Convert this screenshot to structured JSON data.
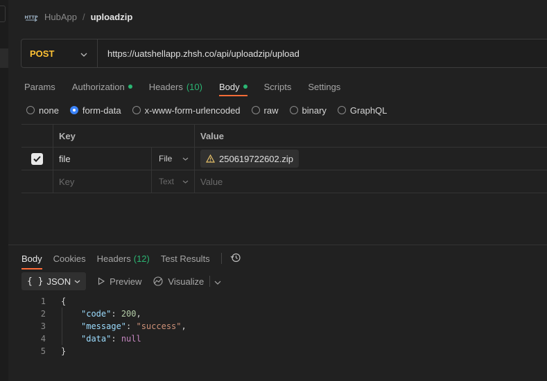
{
  "breadcrumb": {
    "parent": "HubApp",
    "separator": "/",
    "current": "uploadzip"
  },
  "request": {
    "method": "POST",
    "url": "https://uatshellapp.zhsh.co/api/uploadzip/upload"
  },
  "tabs": [
    {
      "label": "Params"
    },
    {
      "label": "Authorization"
    },
    {
      "label": "Headers",
      "count": "(10)"
    },
    {
      "label": "Body"
    },
    {
      "label": "Scripts"
    },
    {
      "label": "Settings"
    }
  ],
  "body_types": [
    "none",
    "form-data",
    "x-www-form-urlencoded",
    "raw",
    "binary",
    "GraphQL"
  ],
  "body_type_selected": "form-data",
  "form_table": {
    "headers": {
      "key": "Key",
      "value": "Value"
    },
    "rows": [
      {
        "checked": true,
        "key": "file",
        "type": "File",
        "value": "250619722602.zip"
      }
    ],
    "placeholder": {
      "key": "Key",
      "type": "Text",
      "value": "Value"
    }
  },
  "response_tabs": [
    {
      "label": "Body"
    },
    {
      "label": "Cookies"
    },
    {
      "label": "Headers",
      "count": "(12)"
    },
    {
      "label": "Test Results"
    }
  ],
  "response_toolbar": {
    "format": "JSON",
    "format_prefix": "{ }",
    "preview": "Preview",
    "visualize": "Visualize"
  },
  "response_json": {
    "lines": [
      "1",
      "2",
      "3",
      "4",
      "5"
    ],
    "open": "{",
    "close": "}",
    "code_key": "\"code\"",
    "code_val": "200",
    "message_key": "\"message\"",
    "message_val": "\"success\"",
    "data_key": "\"data\"",
    "data_val": "null"
  },
  "colors": {
    "method": "#ffc234",
    "accent": "#ff6c37",
    "active_dot": "#2bb673",
    "radio_on": "#3b82f6"
  }
}
